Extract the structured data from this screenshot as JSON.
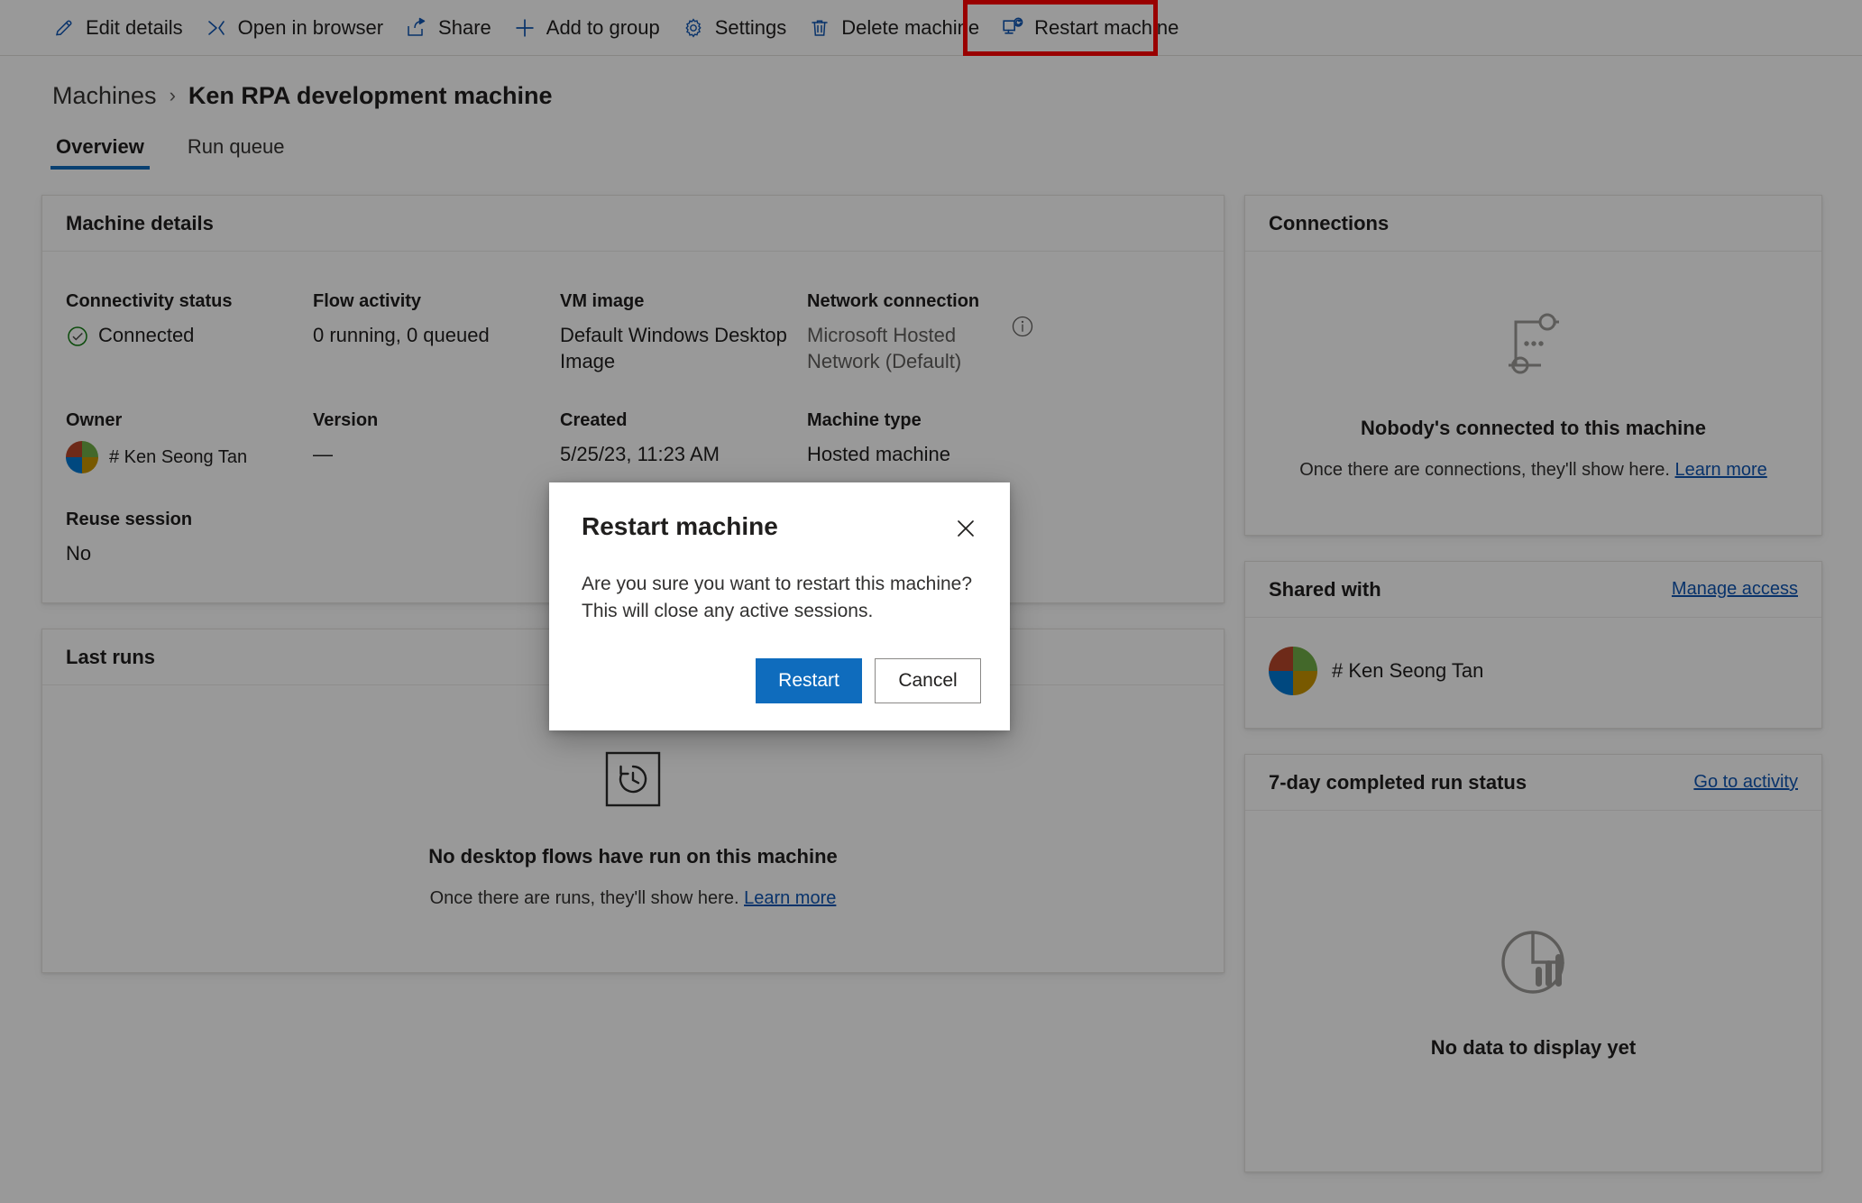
{
  "toolbar": {
    "items": [
      {
        "label": "Edit details",
        "icon": "pencil-icon"
      },
      {
        "label": "Open in browser",
        "icon": "open-in-browser-icon"
      },
      {
        "label": "Share",
        "icon": "share-icon"
      },
      {
        "label": "Add to group",
        "icon": "plus-icon"
      },
      {
        "label": "Settings",
        "icon": "gear-icon"
      },
      {
        "label": "Delete machine",
        "icon": "trash-icon"
      },
      {
        "label": "Restart machine",
        "icon": "restart-machine-icon"
      }
    ],
    "highlighted_item": "Restart machine",
    "highlight_color": "#ff0000"
  },
  "breadcrumb": {
    "root": "Machines",
    "separator": "›",
    "current": "Ken RPA development machine"
  },
  "tabs": [
    {
      "label": "Overview",
      "active": true
    },
    {
      "label": "Run queue",
      "active": false
    }
  ],
  "machine_details": {
    "title": "Machine details",
    "fields": {
      "connectivity_status_label": "Connectivity status",
      "connectivity_status_value": "Connected",
      "flow_activity_label": "Flow activity",
      "flow_activity_value": "0 running, 0 queued",
      "vm_image_label": "VM image",
      "vm_image_value": "Default Windows Desktop Image",
      "network_connection_label": "Network connection",
      "network_connection_value": "Microsoft Hosted Network (Default)",
      "owner_label": "Owner",
      "owner_value": "# Ken Seong Tan",
      "version_label": "Version",
      "version_value": "—",
      "created_label": "Created",
      "created_value": "5/25/23, 11:23 AM",
      "machine_type_label": "Machine type",
      "machine_type_value": "Hosted machine",
      "reuse_session_label": "Reuse session",
      "reuse_session_value": "No"
    }
  },
  "last_runs": {
    "title": "Last runs",
    "empty_title": "No desktop flows have run on this machine",
    "empty_sub": "Once there are runs, they'll show here.",
    "empty_link": "Learn more"
  },
  "connections": {
    "title": "Connections",
    "empty_title": "Nobody's connected to this machine",
    "empty_sub": "Once there are connections, they'll show here.",
    "empty_link": "Learn more"
  },
  "shared_with": {
    "title": "Shared with",
    "action_link": "Manage access",
    "people": [
      {
        "name": "# Ken Seong Tan"
      }
    ]
  },
  "run_status": {
    "title": "7-day completed run status",
    "action_link": "Go to activity",
    "empty_title": "No data to display yet"
  },
  "modal": {
    "title": "Restart machine",
    "body": "Are you sure you want to restart this machine? This will close any active sessions.",
    "confirm_label": "Restart",
    "cancel_label": "Cancel",
    "close_icon": "close-icon"
  },
  "colors": {
    "accent": "#0f6cbd",
    "link": "#0f56b3",
    "success": "#107c10",
    "highlight": "#ff0000"
  }
}
